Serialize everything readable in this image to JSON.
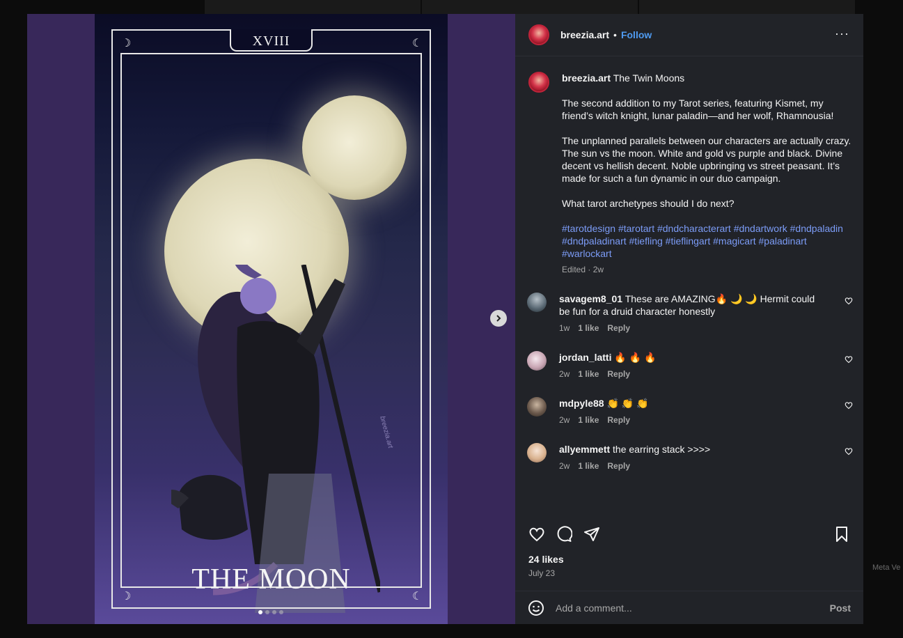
{
  "post": {
    "username": "breezia.art",
    "follow_label": "Follow",
    "separator": "•",
    "more": "···",
    "artwork": {
      "numeral": "XVIII",
      "title": "THE MOON",
      "watermark": "breezia.art",
      "carousel_count": 4,
      "carousel_active": 1
    },
    "caption": {
      "username": "breezia.art",
      "title": "The Twin Moons",
      "p1": "The second addition to my Tarot series, featuring Kismet, my friend’s witch knight, lunar paladin—and her wolf, Rhamnousia!",
      "p2": "The unplanned parallels between our characters are actually crazy. The sun vs the moon. White and gold vs purple and black. Divine decent vs hellish decent. Noble upbringing vs street peasant. It’s made for such a fun dynamic in our duo campaign.",
      "p3": "What tarot archetypes should I do next?",
      "hashtags": "#tarotdesign #tarotart #dndcharacterart #dndartwork #dndpaladin #dndpaladinart #tiefling #tieflingart #magicart #paladinart #warlockart",
      "edited": "Edited · 2w"
    },
    "comments": [
      {
        "user": "savagem8_01",
        "text": "These are AMAZING🔥 🌙 🌙 Hermit could be fun for a druid character honestly",
        "time": "1w",
        "likes": "1 like",
        "reply": "Reply"
      },
      {
        "user": "jordan_latti",
        "text": "🔥 🔥 🔥",
        "time": "2w",
        "likes": "1 like",
        "reply": "Reply"
      },
      {
        "user": "mdpyle88",
        "text": "👏 👏 👏",
        "time": "2w",
        "likes": "1 like",
        "reply": "Reply"
      },
      {
        "user": "allyemmett",
        "text": "the earring stack >>>>",
        "time": "2w",
        "likes": "1 like",
        "reply": "Reply"
      }
    ],
    "likes": "24 likes",
    "date": "July 23",
    "comment_placeholder": "Add a comment...",
    "post_label": "Post"
  },
  "footer": {
    "meta_text": "Meta Ve"
  }
}
